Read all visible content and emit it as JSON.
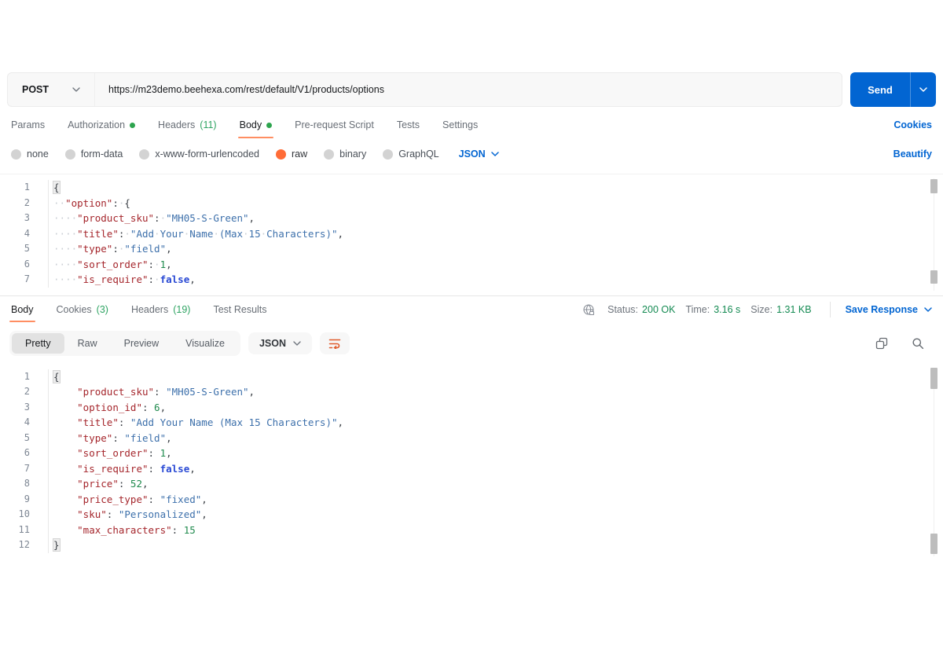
{
  "colors": {
    "accent_orange": "#FF6C37",
    "link_blue": "#0265D2",
    "dot_green": "#2DA44E",
    "status_green": "#148A52",
    "send_button_blue": "#0265D2"
  },
  "request": {
    "method": "POST",
    "url": "https://m23demo.beehexa.com/rest/default/V1/products/options",
    "send_label": "Send",
    "tabs": [
      {
        "label": "Params"
      },
      {
        "label": "Authorization",
        "dot": true
      },
      {
        "label": "Headers",
        "count": "(11)"
      },
      {
        "label": "Body",
        "dot": true,
        "active": true
      },
      {
        "label": "Pre-request Script"
      },
      {
        "label": "Tests"
      },
      {
        "label": "Settings"
      }
    ],
    "cookies_link": "Cookies",
    "body_types": [
      "none",
      "form-data",
      "x-www-form-urlencoded",
      "raw",
      "binary",
      "GraphQL"
    ],
    "selected_body_type": "raw",
    "language": "JSON",
    "beautify_link": "Beautify"
  },
  "request_editor": {
    "show_whitespace": true,
    "lines": [
      {
        "n": "1",
        "tokens": [
          {
            "t": "brace",
            "v": "{"
          }
        ]
      },
      {
        "n": "2",
        "tokens": [
          {
            "t": "ws",
            "v": "  "
          },
          {
            "t": "key",
            "v": "\"option\""
          },
          {
            "t": "p",
            "v": ":"
          },
          {
            "t": "ws",
            "v": " "
          },
          {
            "t": "p",
            "v": "{"
          }
        ]
      },
      {
        "n": "3",
        "tokens": [
          {
            "t": "ws",
            "v": "    "
          },
          {
            "t": "key",
            "v": "\"product_sku\""
          },
          {
            "t": "p",
            "v": ":"
          },
          {
            "t": "ws",
            "v": " "
          },
          {
            "t": "str",
            "v": "\"MH05-S-Green\""
          },
          {
            "t": "p",
            "v": ","
          }
        ]
      },
      {
        "n": "4",
        "tokens": [
          {
            "t": "ws",
            "v": "    "
          },
          {
            "t": "key",
            "v": "\"title\""
          },
          {
            "t": "p",
            "v": ":"
          },
          {
            "t": "ws",
            "v": " "
          },
          {
            "t": "str",
            "v": "\"Add Your Name (Max 15 Characters)\""
          },
          {
            "t": "p",
            "v": ","
          }
        ]
      },
      {
        "n": "5",
        "tokens": [
          {
            "t": "ws",
            "v": "    "
          },
          {
            "t": "key",
            "v": "\"type\""
          },
          {
            "t": "p",
            "v": ":"
          },
          {
            "t": "ws",
            "v": " "
          },
          {
            "t": "str",
            "v": "\"field\""
          },
          {
            "t": "p",
            "v": ","
          }
        ]
      },
      {
        "n": "6",
        "tokens": [
          {
            "t": "ws",
            "v": "    "
          },
          {
            "t": "key",
            "v": "\"sort_order\""
          },
          {
            "t": "p",
            "v": ":"
          },
          {
            "t": "ws",
            "v": " "
          },
          {
            "t": "num",
            "v": "1"
          },
          {
            "t": "p",
            "v": ","
          }
        ]
      },
      {
        "n": "7",
        "tokens": [
          {
            "t": "ws",
            "v": "    "
          },
          {
            "t": "key",
            "v": "\"is_require\""
          },
          {
            "t": "p",
            "v": ":"
          },
          {
            "t": "ws",
            "v": " "
          },
          {
            "t": "bool",
            "v": "false"
          },
          {
            "t": "p",
            "v": ","
          }
        ]
      }
    ]
  },
  "response": {
    "tabs": [
      {
        "label": "Body",
        "active": true
      },
      {
        "label": "Cookies",
        "count": "(3)"
      },
      {
        "label": "Headers",
        "count": "(19)"
      },
      {
        "label": "Test Results"
      }
    ],
    "status_label": "Status:",
    "status_value": "200 OK",
    "time_label": "Time:",
    "time_value": "3.16 s",
    "size_label": "Size:",
    "size_value": "1.31 KB",
    "save_response_label": "Save Response",
    "view_modes": [
      "Pretty",
      "Raw",
      "Preview",
      "Visualize"
    ],
    "active_view_mode": "Pretty",
    "language": "JSON"
  },
  "response_editor": {
    "show_whitespace": false,
    "lines": [
      {
        "n": "1",
        "tokens": [
          {
            "t": "brace",
            "v": "{"
          }
        ]
      },
      {
        "n": "2",
        "tokens": [
          {
            "t": "ws",
            "v": "    "
          },
          {
            "t": "key",
            "v": "\"product_sku\""
          },
          {
            "t": "p",
            "v": ": "
          },
          {
            "t": "str",
            "v": "\"MH05-S-Green\""
          },
          {
            "t": "p",
            "v": ","
          }
        ]
      },
      {
        "n": "3",
        "tokens": [
          {
            "t": "ws",
            "v": "    "
          },
          {
            "t": "key",
            "v": "\"option_id\""
          },
          {
            "t": "p",
            "v": ": "
          },
          {
            "t": "num",
            "v": "6"
          },
          {
            "t": "p",
            "v": ","
          }
        ]
      },
      {
        "n": "4",
        "tokens": [
          {
            "t": "ws",
            "v": "    "
          },
          {
            "t": "key",
            "v": "\"title\""
          },
          {
            "t": "p",
            "v": ": "
          },
          {
            "t": "str",
            "v": "\"Add Your Name (Max 15 Characters)\""
          },
          {
            "t": "p",
            "v": ","
          }
        ]
      },
      {
        "n": "5",
        "tokens": [
          {
            "t": "ws",
            "v": "    "
          },
          {
            "t": "key",
            "v": "\"type\""
          },
          {
            "t": "p",
            "v": ": "
          },
          {
            "t": "str",
            "v": "\"field\""
          },
          {
            "t": "p",
            "v": ","
          }
        ]
      },
      {
        "n": "6",
        "tokens": [
          {
            "t": "ws",
            "v": "    "
          },
          {
            "t": "key",
            "v": "\"sort_order\""
          },
          {
            "t": "p",
            "v": ": "
          },
          {
            "t": "num",
            "v": "1"
          },
          {
            "t": "p",
            "v": ","
          }
        ]
      },
      {
        "n": "7",
        "tokens": [
          {
            "t": "ws",
            "v": "    "
          },
          {
            "t": "key",
            "v": "\"is_require\""
          },
          {
            "t": "p",
            "v": ": "
          },
          {
            "t": "bool",
            "v": "false"
          },
          {
            "t": "p",
            "v": ","
          }
        ]
      },
      {
        "n": "8",
        "tokens": [
          {
            "t": "ws",
            "v": "    "
          },
          {
            "t": "key",
            "v": "\"price\""
          },
          {
            "t": "p",
            "v": ": "
          },
          {
            "t": "num",
            "v": "52"
          },
          {
            "t": "p",
            "v": ","
          }
        ]
      },
      {
        "n": "9",
        "tokens": [
          {
            "t": "ws",
            "v": "    "
          },
          {
            "t": "key",
            "v": "\"price_type\""
          },
          {
            "t": "p",
            "v": ": "
          },
          {
            "t": "str",
            "v": "\"fixed\""
          },
          {
            "t": "p",
            "v": ","
          }
        ]
      },
      {
        "n": "10",
        "tokens": [
          {
            "t": "ws",
            "v": "    "
          },
          {
            "t": "key",
            "v": "\"sku\""
          },
          {
            "t": "p",
            "v": ": "
          },
          {
            "t": "str",
            "v": "\"Personalized\""
          },
          {
            "t": "p",
            "v": ","
          }
        ]
      },
      {
        "n": "11",
        "tokens": [
          {
            "t": "ws",
            "v": "    "
          },
          {
            "t": "key",
            "v": "\"max_characters\""
          },
          {
            "t": "p",
            "v": ": "
          },
          {
            "t": "num",
            "v": "15"
          }
        ]
      },
      {
        "n": "12",
        "tokens": [
          {
            "t": "brace",
            "v": "}"
          }
        ]
      }
    ]
  }
}
